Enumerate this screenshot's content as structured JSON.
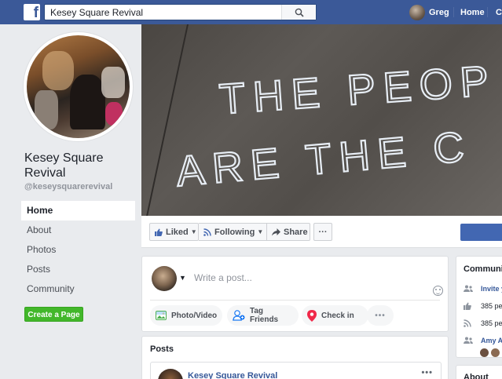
{
  "topbar": {
    "logo": "f",
    "search_value": "Kesey Square Revival",
    "user_name": "Greg",
    "home_label": "Home",
    "truncated_label": "C"
  },
  "page": {
    "name": "Kesey Square Revival",
    "handle": "@keseysquarerevival"
  },
  "nav": {
    "items": [
      "Home",
      "About",
      "Photos",
      "Posts",
      "Community"
    ],
    "active": "Home"
  },
  "create_page_label": "Create a Page",
  "cover": {
    "chalk_line1": "THE PEOP",
    "chalk_line2": "ARE THE C"
  },
  "actions": {
    "liked": "Liked",
    "following": "Following",
    "share": "Share",
    "more": "···"
  },
  "composer": {
    "placeholder": "Write a post...",
    "photo_video": "Photo/Video",
    "tag_friends": "Tag Friends",
    "check_in": "Check in",
    "more": "•••"
  },
  "posts": {
    "title": "Posts",
    "first_author": "Kesey Square Revival",
    "more": "•••"
  },
  "community": {
    "title": "Communi",
    "invite": "Invite y",
    "likes": "385 pe",
    "follows": "385 pe",
    "friends": "Amy A"
  },
  "about": {
    "title": "About"
  },
  "colors": {
    "brand": "#3b5998",
    "green": "#42b72a",
    "link": "#365899"
  }
}
